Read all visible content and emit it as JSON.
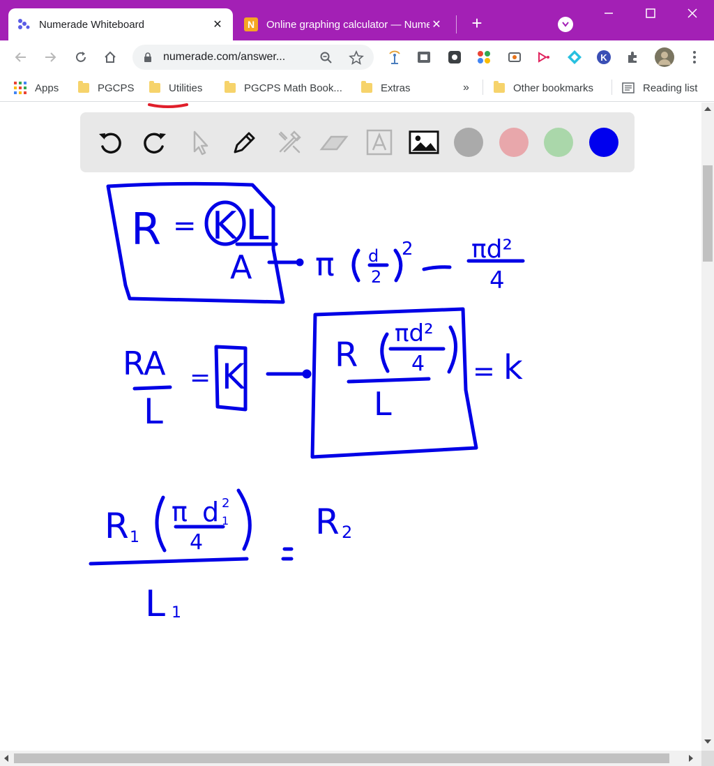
{
  "tabs": [
    {
      "title": "Numerade Whiteboard",
      "active": true
    },
    {
      "title": "Online graphing calculator — Numerade",
      "active": false
    }
  ],
  "tab_close_glyph": "✕",
  "new_tab_glyph": "+",
  "address": {
    "url": "numerade.com/answer..."
  },
  "bookmarks": [
    {
      "label": "Apps"
    },
    {
      "label": "PGCPS"
    },
    {
      "label": "Utilities"
    },
    {
      "label": "PGCPS Math Book..."
    },
    {
      "label": "Extras"
    },
    {
      "label": "Other bookmarks"
    },
    {
      "label": "Reading list"
    }
  ],
  "bookmarks_overflow": "»",
  "whiteboard": {
    "tools": [
      "undo-icon",
      "redo-icon",
      "pointer-icon",
      "pen-icon",
      "tools-icon",
      "eraser-icon",
      "text-icon",
      "image-icon"
    ],
    "colors": [
      "#aaaaaa",
      "#e8a7ab",
      "#aad7aa",
      "#0000ee"
    ]
  },
  "handwriting": {
    "eq1_R": "R",
    "eq1_equals": "=",
    "eq1_k": "K",
    "eq1_L": "L",
    "eq1_A": "A",
    "area_pi": "π",
    "area_d": "d",
    "area_two": "2",
    "area_exp": "2",
    "area_result_num": "πd²",
    "area_result_den": "4",
    "eq2_RA": "RA",
    "eq2_L": "L",
    "eq2_equals": "=",
    "eq2_k": "K",
    "eq3_R": "R",
    "eq3_num": "πd²",
    "eq3_den": "4",
    "eq3_L": "L",
    "eq3_equals": "=",
    "eq3_k": "k",
    "eq4_R1": "R",
    "eq4_sub1": "1",
    "eq4_pi": "π",
    "eq4_d": "d",
    "eq4_dsup": "2",
    "eq4_dsub": "1",
    "eq4_den": "4",
    "eq4_L": "L",
    "eq4_Lsub": "1",
    "eq4_equals": "=",
    "eq4_R2": "R",
    "eq4_R2sub": "2"
  }
}
